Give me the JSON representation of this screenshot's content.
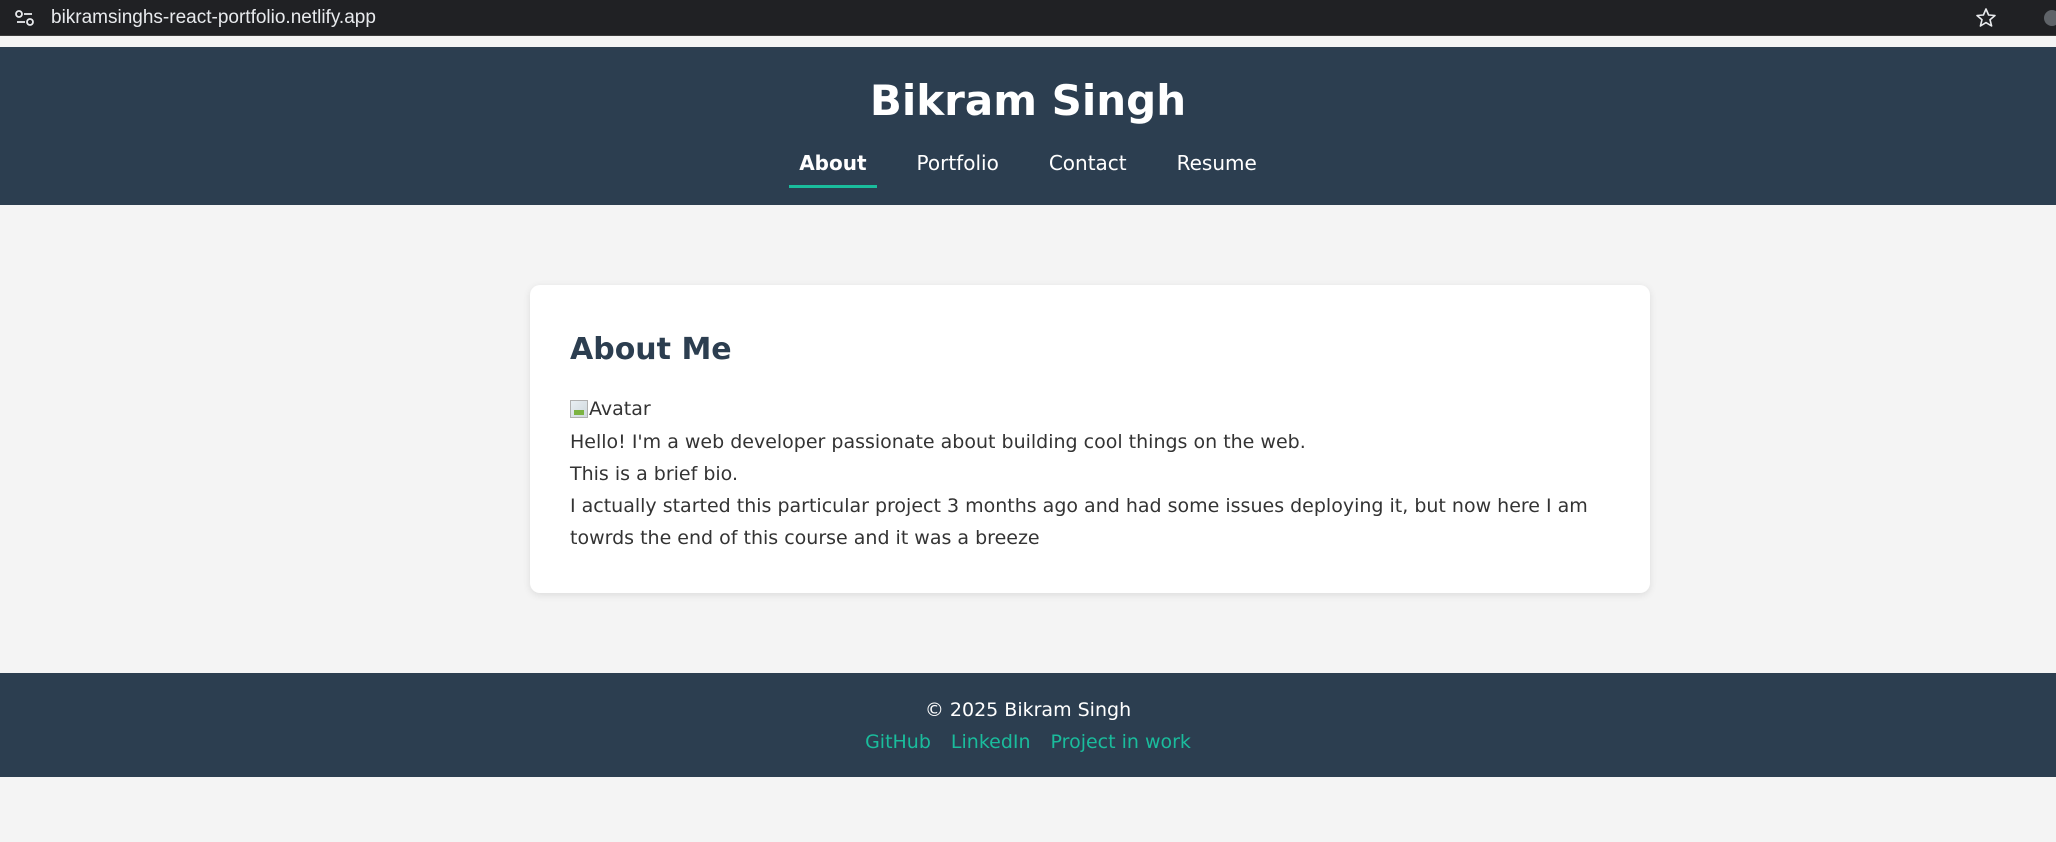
{
  "browser": {
    "url": "bikramsinghs-react-portfolio.netlify.app"
  },
  "header": {
    "title": "Bikram Singh",
    "nav": [
      {
        "label": "About",
        "active": true
      },
      {
        "label": "Portfolio",
        "active": false
      },
      {
        "label": "Contact",
        "active": false
      },
      {
        "label": "Resume",
        "active": false
      }
    ]
  },
  "about": {
    "heading": "About Me",
    "avatar_alt": "Avatar",
    "bio": [
      "Hello! I'm a web developer passionate about building cool things on the web.",
      "This is a brief bio.",
      "I actually started this particular project 3 months ago and had some issues deploying it, but now here I am towrds the end of this course and it was a breeze"
    ]
  },
  "footer": {
    "copyright": "© 2025 Bikram Singh",
    "links": [
      "GitHub",
      "LinkedIn",
      "Project in work"
    ]
  },
  "colors": {
    "header_bg": "#2c3e50",
    "accent": "#1abc9c",
    "page_bg": "#f4f4f4",
    "card_bg": "#ffffff"
  },
  "icons": {
    "site_info": "tune-icon",
    "bookmark": "star-icon"
  }
}
